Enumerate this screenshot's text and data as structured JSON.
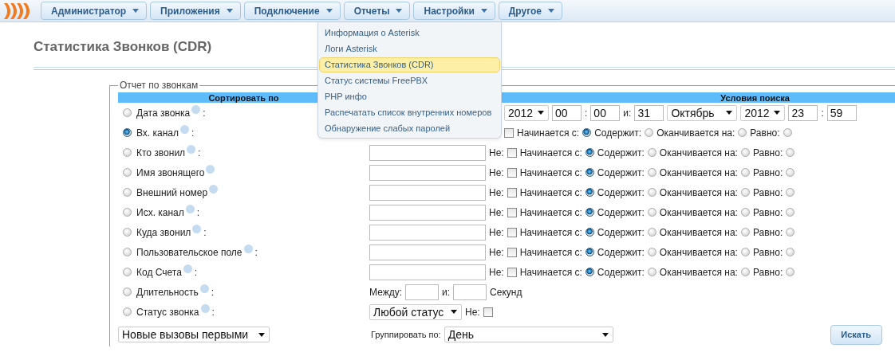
{
  "nav": {
    "items": [
      {
        "label": "Администратор"
      },
      {
        "label": "Приложения"
      },
      {
        "label": "Подключение"
      },
      {
        "label": "Отчеты"
      },
      {
        "label": "Настройки"
      },
      {
        "label": "Другое"
      }
    ]
  },
  "menu": {
    "items": [
      {
        "label": "Информация о Asterisk",
        "selected": false
      },
      {
        "label": "Логи Asterisk",
        "selected": false
      },
      {
        "label": "Статистика Звонков (CDR)",
        "selected": true
      },
      {
        "label": "Статус системы FreePBX",
        "selected": false
      },
      {
        "label": "PHP инфо",
        "selected": false
      },
      {
        "label": "Распечатать список внутренних номеров",
        "selected": false
      },
      {
        "label": "Обнаружение слабых паролей",
        "selected": false
      }
    ]
  },
  "title": "Статистика Звонков (CDR)",
  "report": {
    "legend": "Отчет по звонкам",
    "sort_heading": "Сортировать по",
    "search_heading": "Условия поиска",
    "rows": [
      {
        "label": "Дата звонка",
        "suffix": ":",
        "selected": false,
        "covered": true,
        "filter": [
          {
            "kind": "year-select",
            "value": "2012"
          },
          {
            "kind": "time-field",
            "value": "00"
          },
          {
            "kind": "text",
            "text": ":"
          },
          {
            "kind": "time-field",
            "value": "00"
          },
          {
            "kind": "text",
            "text": "и:"
          },
          {
            "kind": "time-field",
            "value": "31"
          },
          {
            "kind": "month-select",
            "value": "Октябрь"
          },
          {
            "kind": "year-select",
            "value": "2012"
          },
          {
            "kind": "time-field",
            "value": "23"
          },
          {
            "kind": "text",
            "text": ":"
          },
          {
            "kind": "time-field",
            "value": "59"
          }
        ]
      },
      {
        "label": "Вх. канал",
        "suffix": ":",
        "selected": true,
        "covered": true,
        "filter": [
          {
            "kind": "checkbox",
            "checked": false
          },
          {
            "kind": "text",
            "text": "Начинается с:"
          },
          {
            "kind": "radio",
            "selected": true
          },
          {
            "kind": "text",
            "text": "Содержит:"
          },
          {
            "kind": "radio",
            "selected": false
          },
          {
            "kind": "text",
            "text": "Оканчивается на:"
          },
          {
            "kind": "radio",
            "selected": false
          },
          {
            "kind": "text",
            "text": "Равно:"
          },
          {
            "kind": "radio",
            "selected": false
          }
        ]
      },
      {
        "label": "Кто звонил",
        "suffix": ":",
        "selected": false,
        "covered": false,
        "filter": [
          {
            "kind": "text-field"
          },
          {
            "kind": "text",
            "text": "Не:"
          },
          {
            "kind": "checkbox",
            "checked": false
          },
          {
            "kind": "text",
            "text": "Начинается с:"
          },
          {
            "kind": "radio",
            "selected": true
          },
          {
            "kind": "text",
            "text": "Содержит:"
          },
          {
            "kind": "radio",
            "selected": false
          },
          {
            "kind": "text",
            "text": "Оканчивается на:"
          },
          {
            "kind": "radio",
            "selected": false
          },
          {
            "kind": "text",
            "text": "Равно:"
          },
          {
            "kind": "radio",
            "selected": false
          }
        ]
      },
      {
        "label": "Имя звонящего",
        "selected": false,
        "covered": false,
        "filter": [
          {
            "kind": "text-field"
          },
          {
            "kind": "text",
            "text": "Не:"
          },
          {
            "kind": "checkbox",
            "checked": false
          },
          {
            "kind": "text",
            "text": "Начинается с:"
          },
          {
            "kind": "radio",
            "selected": true
          },
          {
            "kind": "text",
            "text": "Содержит:"
          },
          {
            "kind": "radio",
            "selected": false
          },
          {
            "kind": "text",
            "text": "Оканчивается на:"
          },
          {
            "kind": "radio",
            "selected": false
          },
          {
            "kind": "text",
            "text": "Равно:"
          },
          {
            "kind": "radio",
            "selected": false
          }
        ]
      },
      {
        "label": "Внешний номер",
        "selected": false,
        "covered": false,
        "filter": [
          {
            "kind": "text-field"
          },
          {
            "kind": "text",
            "text": "Не:"
          },
          {
            "kind": "checkbox",
            "checked": false
          },
          {
            "kind": "text",
            "text": "Начинается с:"
          },
          {
            "kind": "radio",
            "selected": true
          },
          {
            "kind": "text",
            "text": "Содержит:"
          },
          {
            "kind": "radio",
            "selected": false
          },
          {
            "kind": "text",
            "text": "Оканчивается на:"
          },
          {
            "kind": "radio",
            "selected": false
          },
          {
            "kind": "text",
            "text": "Равно:"
          },
          {
            "kind": "radio",
            "selected": false
          }
        ]
      },
      {
        "label": "Исх. канал",
        "suffix": ":",
        "selected": false,
        "covered": false,
        "filter": [
          {
            "kind": "text-field"
          },
          {
            "kind": "text",
            "text": "Не:"
          },
          {
            "kind": "checkbox",
            "checked": false
          },
          {
            "kind": "text",
            "text": "Начинается с:"
          },
          {
            "kind": "radio",
            "selected": true
          },
          {
            "kind": "text",
            "text": "Содержит:"
          },
          {
            "kind": "radio",
            "selected": false
          },
          {
            "kind": "text",
            "text": "Оканчивается на:"
          },
          {
            "kind": "radio",
            "selected": false
          },
          {
            "kind": "text",
            "text": "Равно:"
          },
          {
            "kind": "radio",
            "selected": false
          }
        ]
      },
      {
        "label": "Куда звонил",
        "suffix": ":",
        "selected": false,
        "covered": false,
        "filter": [
          {
            "kind": "text-field"
          },
          {
            "kind": "text",
            "text": "Не:"
          },
          {
            "kind": "checkbox",
            "checked": false
          },
          {
            "kind": "text",
            "text": "Начинается с:"
          },
          {
            "kind": "radio",
            "selected": true
          },
          {
            "kind": "text",
            "text": "Содержит:"
          },
          {
            "kind": "radio",
            "selected": false
          },
          {
            "kind": "text",
            "text": "Оканчивается на:"
          },
          {
            "kind": "radio",
            "selected": false
          },
          {
            "kind": "text",
            "text": "Равно:"
          },
          {
            "kind": "radio",
            "selected": false
          }
        ]
      },
      {
        "label": "Пользовательское поле",
        "suffix": ":",
        "selected": false,
        "covered": false,
        "filter": [
          {
            "kind": "text-field"
          },
          {
            "kind": "text",
            "text": "Не:"
          },
          {
            "kind": "checkbox",
            "checked": false
          },
          {
            "kind": "text",
            "text": "Начинается с:"
          },
          {
            "kind": "radio",
            "selected": true
          },
          {
            "kind": "text",
            "text": "Содержит:"
          },
          {
            "kind": "radio",
            "selected": false
          },
          {
            "kind": "text",
            "text": "Оканчивается на:"
          },
          {
            "kind": "radio",
            "selected": false
          },
          {
            "kind": "text",
            "text": "Равно:"
          },
          {
            "kind": "radio",
            "selected": false
          }
        ]
      },
      {
        "label": "Код Счета",
        "suffix": ":",
        "selected": false,
        "covered": false,
        "filter": [
          {
            "kind": "text-field"
          },
          {
            "kind": "text",
            "text": "Не:"
          },
          {
            "kind": "checkbox",
            "checked": false
          },
          {
            "kind": "text",
            "text": "Начинается с:"
          },
          {
            "kind": "radio",
            "selected": true
          },
          {
            "kind": "text",
            "text": "Содержит:"
          },
          {
            "kind": "radio",
            "selected": false
          },
          {
            "kind": "text",
            "text": "Оканчивается на:"
          },
          {
            "kind": "radio",
            "selected": false
          },
          {
            "kind": "text",
            "text": "Равно:"
          },
          {
            "kind": "radio",
            "selected": false
          }
        ]
      },
      {
        "label": "Длительность",
        "suffix": ":",
        "selected": false,
        "covered": false,
        "filter": [
          {
            "kind": "text",
            "text": "Между:"
          },
          {
            "kind": "seconds-field"
          },
          {
            "kind": "text",
            "text": "и:"
          },
          {
            "kind": "seconds-field"
          },
          {
            "kind": "text",
            "text": "Секунд"
          }
        ]
      },
      {
        "label": "Статус звонка",
        "suffix": ":",
        "selected": false,
        "covered": false,
        "filter": [
          {
            "kind": "status-select",
            "value": "Любой статус"
          },
          {
            "kind": "text",
            "text": "Не:"
          },
          {
            "kind": "checkbox",
            "checked": false
          }
        ]
      }
    ],
    "order_select": "Новые вызовы первыми",
    "group_label": "Группировать по:",
    "group_select": "День",
    "search_button": "Искать"
  }
}
